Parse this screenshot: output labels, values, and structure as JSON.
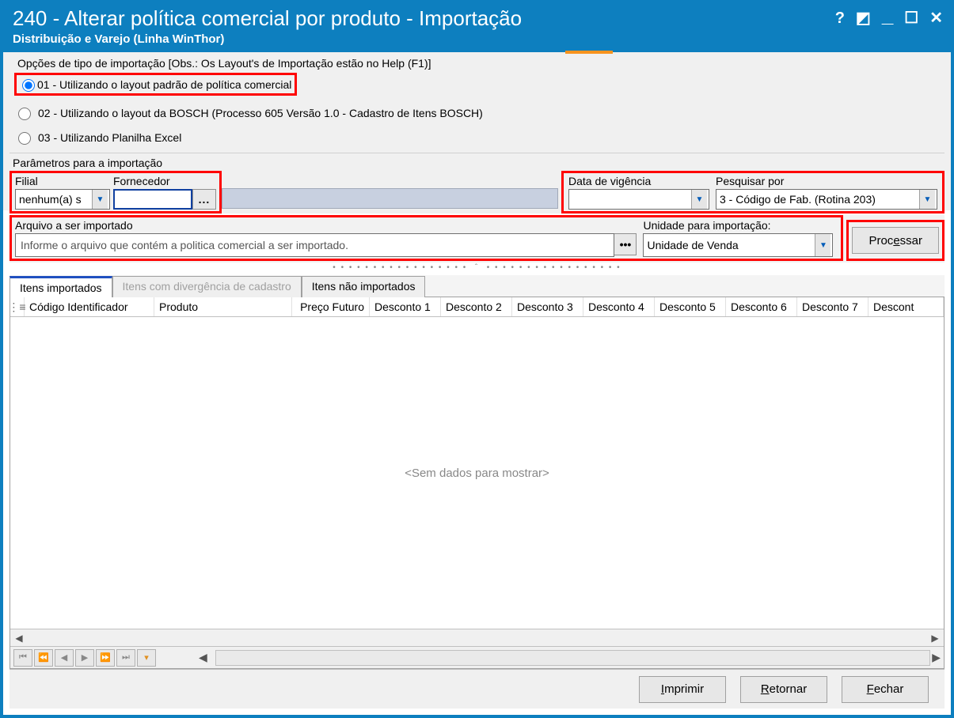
{
  "window": {
    "title": "240 - Alterar política comercial por produto - Importação",
    "subtitle": "Distribuição e Varejo (Linha WinThor)"
  },
  "options_group": {
    "label": "Opções de tipo de importação  [Obs.: Os Layout's de Importação estão no Help (F1)]",
    "opt1": "01 - Utilizando o layout padrão de política comercial",
    "opt2": "02 - Utilizando o layout da BOSCH (Processo 605 Versão 1.0 - Cadastro de Itens BOSCH)",
    "opt3": "03 - Utilizando Planilha Excel"
  },
  "params": {
    "group_label": "Parâmetros para a importação",
    "filial_label": "Filial",
    "filial_value": "nenhum(a) s",
    "fornecedor_label": "Fornecedor",
    "fornecedor_value": "",
    "data_vigencia_label": "Data de vigência",
    "data_vigencia_value": "",
    "pesquisar_label": "Pesquisar por",
    "pesquisar_value": "3 - Código de Fab. (Rotina 203)",
    "arquivo_label": "Arquivo a ser importado",
    "arquivo_placeholder": "Informe o arquivo que contém a politica comercial a ser importado.",
    "unidade_label": "Unidade para importação:",
    "unidade_value": "Unidade de Venda",
    "processar": "Processar"
  },
  "tabs": {
    "t1": "Itens importados",
    "t2": "Itens com divergência de cadastro",
    "t3": "Itens não importados"
  },
  "grid": {
    "columns": [
      "Código Identificador",
      "Produto",
      "Preço Futuro",
      "Desconto 1",
      "Desconto 2",
      "Desconto 3",
      "Desconto 4",
      "Desconto 5",
      "Desconto 6",
      "Desconto 7",
      "Descont"
    ],
    "empty": "<Sem dados para mostrar>"
  },
  "buttons": {
    "imprimir": "Imprimir",
    "retornar_pre": "R",
    "retornar_post": "etornar",
    "fechar_pre": "F",
    "fechar_post": "echar",
    "processar_pre": "Proc",
    "processar_post": "ssar",
    "processar_u": "e"
  }
}
